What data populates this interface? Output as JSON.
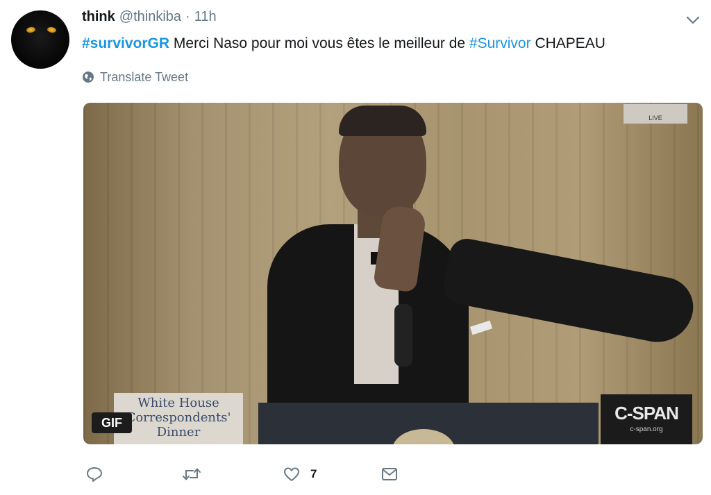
{
  "tweet": {
    "author": {
      "name": "think",
      "handle": "@thinkiba",
      "separator": "·",
      "time": "11h"
    },
    "text": {
      "hashtag1": "#survivorGR",
      "body": " Merci Naso pour moi vous êtes le meilleur de ",
      "hashtag2": "#Survivor",
      "tail": " CHAPEAU"
    },
    "translate_label": "Translate Tweet",
    "media": {
      "badge": "GIF",
      "sign_text": [
        "White House",
        "Correspondents'",
        "Dinner"
      ],
      "network_logo": "C-SPAN",
      "network_url": "c-span.org",
      "live_bug": "LIVE"
    },
    "actions": {
      "reply_icon": "reply-icon",
      "retweet_icon": "retweet-icon",
      "like_icon": "heart-icon",
      "like_count": "7",
      "dm_icon": "envelope-icon"
    }
  },
  "colors": {
    "link": "#1b95e0",
    "muted": "#657786",
    "text": "#14171a"
  }
}
